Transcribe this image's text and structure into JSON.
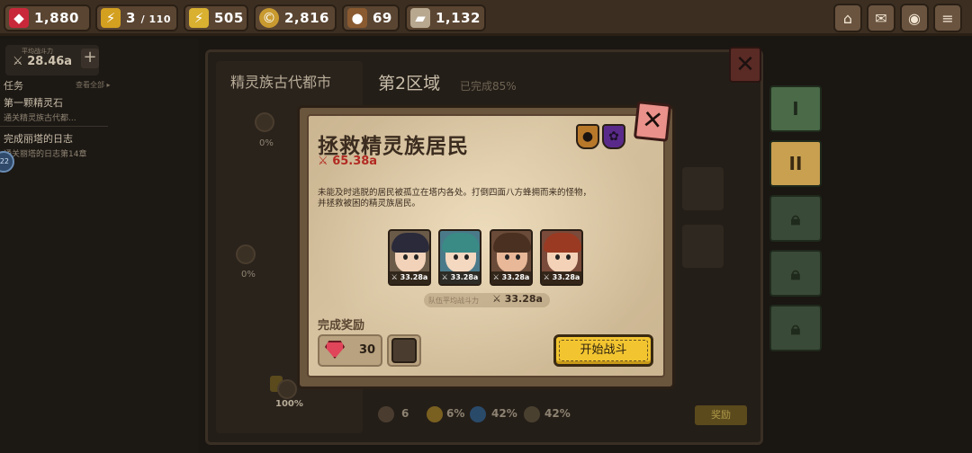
{
  "resources": [
    {
      "name": "gems",
      "icon": "gem-icon",
      "value": "1,880"
    },
    {
      "name": "stamina",
      "icon": "lightning-icon",
      "value": "3",
      "max": "110"
    },
    {
      "name": "xp",
      "icon": "xp-bolt-icon",
      "value": "505"
    },
    {
      "name": "gold",
      "icon": "coin-icon",
      "value": "2,816"
    },
    {
      "name": "wood",
      "icon": "wood-icon",
      "value": "69"
    },
    {
      "name": "stone",
      "icon": "stone-icon",
      "value": "1,132"
    }
  ],
  "topButtons": [
    "home-icon",
    "mail-icon",
    "camera-icon",
    "menu-icon"
  ],
  "background": {
    "powerLabel": "平均战斗力",
    "powerValue": "28.46a",
    "tasksTitle": "任务",
    "tasksMore": "查看全部 ▸",
    "tasks": [
      {
        "name": "第一颗精灵石",
        "desc": "通关精灵族古代都..."
      },
      {
        "name": "完成丽塔的日志",
        "desc": "通关丽塔的日志第14章"
      }
    ],
    "bubble": "22",
    "cityTitle": "精灵族古代都市",
    "stagePcts": [
      "0%",
      "0%",
      "100%"
    ],
    "regionTitle": "第2区域",
    "regionDone": "已完成85%",
    "closeLabel": "✕",
    "sideTabs": [
      "I",
      "II"
    ],
    "bottom": {
      "count": "6",
      "gold": "6%",
      "water": "42%",
      "other": "42%"
    },
    "rewardBtn": "奖励"
  },
  "modal": {
    "title": "拯救精灵族居民",
    "power": "65.38a",
    "closeLabel": "✕",
    "description": "未能及时逃脱的居民被孤立在塔内各处。打倒四面八方蜂拥而来的怪物，\n并拯救被困的精灵族居民。",
    "badges": [
      "helmet-icon",
      "paw-icon"
    ],
    "heroes": [
      {
        "name": "hero-1",
        "power": "33.28a",
        "hair": "#2a2a3a",
        "skin": "#f2d2b8",
        "bg": "#6a5a48"
      },
      {
        "name": "hero-2",
        "power": "33.28a",
        "hair": "#3a8a86",
        "skin": "#f4d8c0",
        "bg": "#4a7a8a"
      },
      {
        "name": "hero-3",
        "power": "33.28a",
        "hair": "#4a3020",
        "skin": "#e8b898",
        "bg": "#6a4a38"
      },
      {
        "name": "hero-4",
        "power": "33.28a",
        "hair": "#9a3a22",
        "skin": "#f4d2b8",
        "bg": "#7a4a3a"
      }
    ],
    "teamAvgLabel": "队伍平均战斗力",
    "teamAvgValue": "33.28a",
    "rewardTitle": "完成奖励",
    "rewardGemCount": "30",
    "startButton": "开始战斗"
  },
  "colors": {
    "accent": "#f2c530",
    "danger": "#b22a22",
    "parchment": "#d7c3a0"
  }
}
